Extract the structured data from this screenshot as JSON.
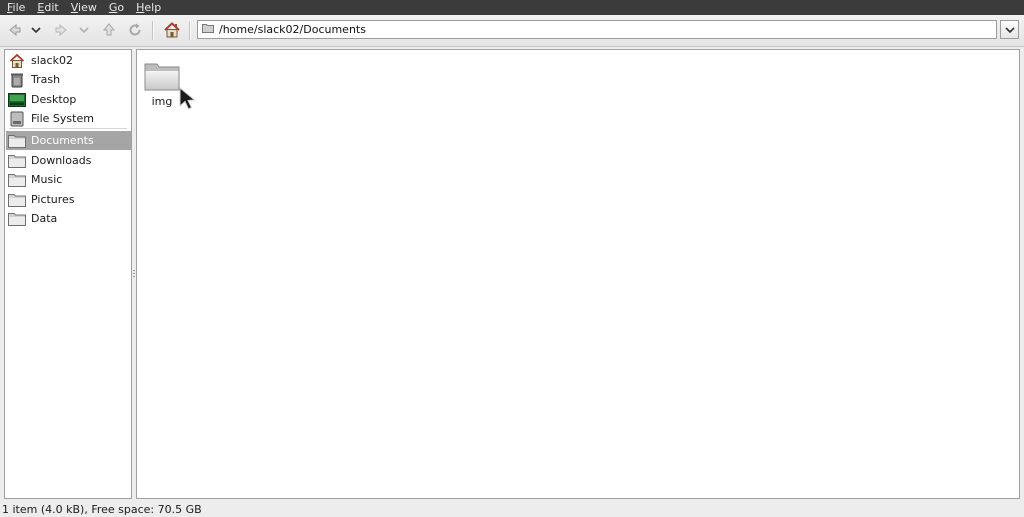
{
  "menubar": {
    "items": [
      "File",
      "Edit",
      "View",
      "Go",
      "Help"
    ]
  },
  "location": {
    "path": "/home/slack02/Documents"
  },
  "sidebar": {
    "places": [
      {
        "label": "slack02",
        "icon": "home-icon"
      },
      {
        "label": "Trash",
        "icon": "trash-icon"
      },
      {
        "label": "Desktop",
        "icon": "desktop-icon"
      },
      {
        "label": "File System",
        "icon": "drive-icon"
      }
    ],
    "bookmarks": [
      {
        "label": "Documents",
        "icon": "folder-icon",
        "selected": true
      },
      {
        "label": "Downloads",
        "icon": "folder-icon"
      },
      {
        "label": "Music",
        "icon": "folder-icon"
      },
      {
        "label": "Pictures",
        "icon": "folder-icon"
      },
      {
        "label": "Data",
        "icon": "folder-icon"
      }
    ]
  },
  "files": [
    {
      "name": "img",
      "icon": "folder-icon"
    }
  ],
  "status": {
    "text": "1 item (4.0 kB), Free space: 70.5 GB"
  },
  "colors": {
    "menubar_bg": "#3b3b3b",
    "selection": "#a5a5a5",
    "home_roof": "#c0392b"
  }
}
